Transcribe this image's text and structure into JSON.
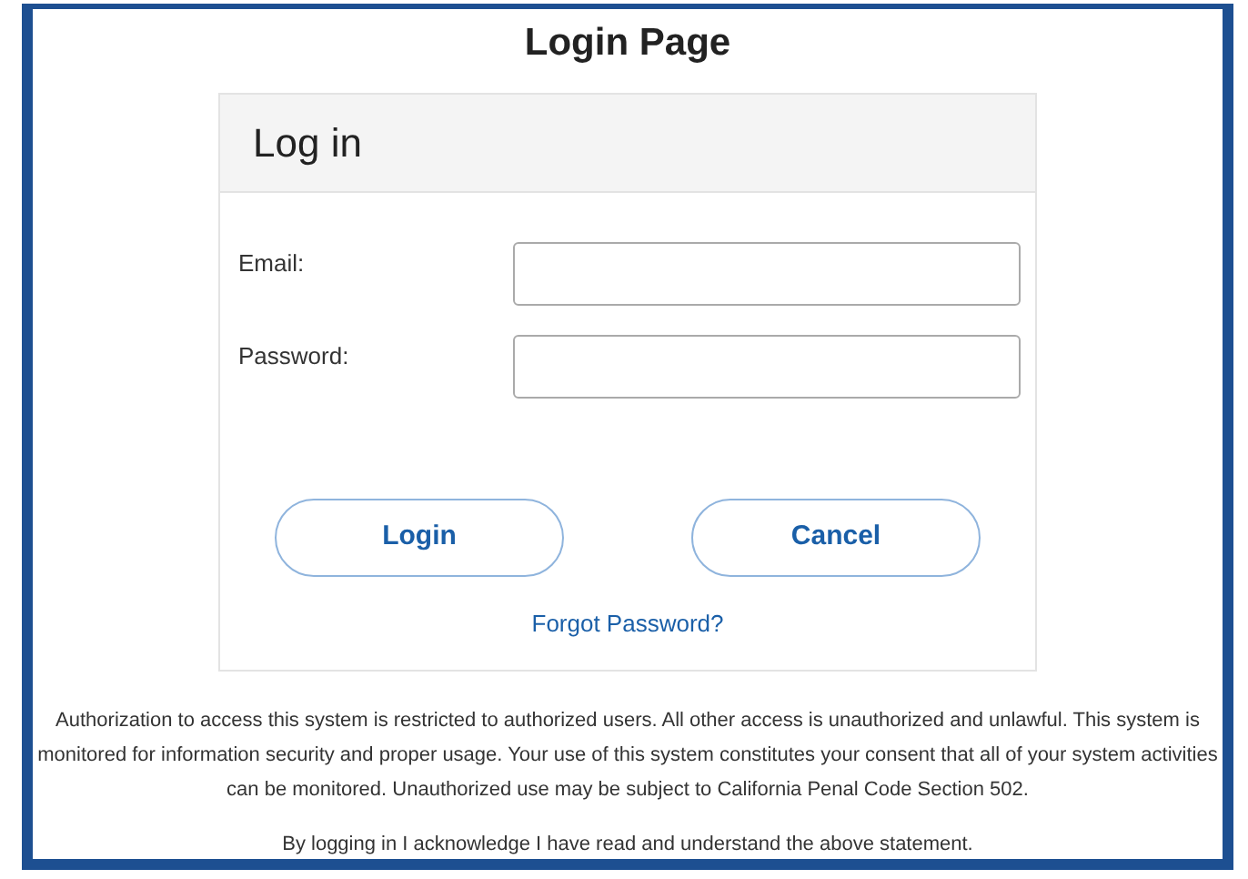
{
  "page_title": "Login Page",
  "card": {
    "title": "Log in",
    "fields": [
      {
        "label": "Email:"
      },
      {
        "label": "Password:"
      }
    ],
    "buttons": [
      "Login",
      "Cancel"
    ],
    "link": "Forgot Password?"
  },
  "notice": "Authorization to access this system is restricted to authorized users. All other access is unauthorized and unlawful. This system is monitored for information security and proper usage. Your use of this system constitutes your consent that all of your system activities can be monitored. Unauthorized use may be subject to California Penal Code Section 502.",
  "acknowledgement": "By logging in I acknowledge I have read and understand the above statement."
}
